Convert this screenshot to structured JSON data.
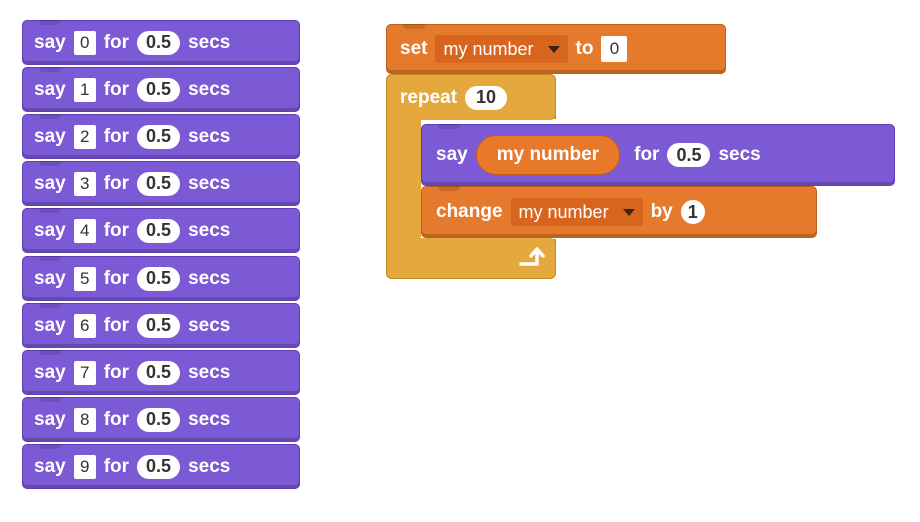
{
  "say_blocks": [
    {
      "say": "say",
      "value": "0",
      "for": "for",
      "secs_value": "0.5",
      "secs": "secs"
    },
    {
      "say": "say",
      "value": "1",
      "for": "for",
      "secs_value": "0.5",
      "secs": "secs"
    },
    {
      "say": "say",
      "value": "2",
      "for": "for",
      "secs_value": "0.5",
      "secs": "secs"
    },
    {
      "say": "say",
      "value": "3",
      "for": "for",
      "secs_value": "0.5",
      "secs": "secs"
    },
    {
      "say": "say",
      "value": "4",
      "for": "for",
      "secs_value": "0.5",
      "secs": "secs"
    },
    {
      "say": "say",
      "value": "5",
      "for": "for",
      "secs_value": "0.5",
      "secs": "secs"
    },
    {
      "say": "say",
      "value": "6",
      "for": "for",
      "secs_value": "0.5",
      "secs": "secs"
    },
    {
      "say": "say",
      "value": "7",
      "for": "for",
      "secs_value": "0.5",
      "secs": "secs"
    },
    {
      "say": "say",
      "value": "8",
      "for": "for",
      "secs_value": "0.5",
      "secs": "secs"
    },
    {
      "say": "say",
      "value": "9",
      "for": "for",
      "secs_value": "0.5",
      "secs": "secs"
    }
  ],
  "script": {
    "set_label": "set",
    "set_variable": "my number",
    "to_label": "to",
    "set_value": "0",
    "repeat_label": "repeat",
    "repeat_count": "10",
    "say_label": "say",
    "say_variable": "my number",
    "for_label": "for",
    "say_secs": "0.5",
    "secs_label": "secs",
    "change_label": "change",
    "change_variable": "my number",
    "by_label": "by",
    "change_value": "1",
    "loop_arrow_icon": "loop-arrow-icon"
  },
  "colors": {
    "looks": "#7c5ad6",
    "data": "#e57a2c",
    "control": "#e4a83c"
  }
}
